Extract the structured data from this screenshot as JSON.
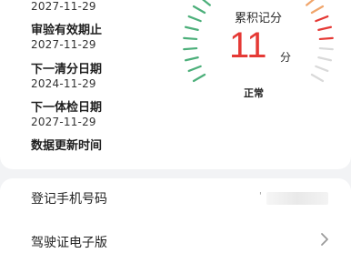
{
  "license_info": {
    "first_value": "2027-11-29",
    "review_expiry_label": "审验有效期止",
    "review_expiry_value": "2027-11-29",
    "next_clear_label": "下一清分日期",
    "next_clear_value": "2024-11-29",
    "next_exam_label": "下一体检日期",
    "next_exam_value": "2027-11-29",
    "data_update_label": "数据更新时间"
  },
  "score_gauge": {
    "title": "累积记分",
    "score": "11",
    "unit": "分",
    "status": "正常",
    "colors": {
      "safe": "#4caf7a",
      "warn": "#f0a56b",
      "danger": "#e53935",
      "inactive": "#d9d9d9"
    }
  },
  "settings_list": {
    "phone_label": "登记手机号码",
    "phone_value_prefix": "'",
    "e_license_label": "驾驶证电子版"
  }
}
